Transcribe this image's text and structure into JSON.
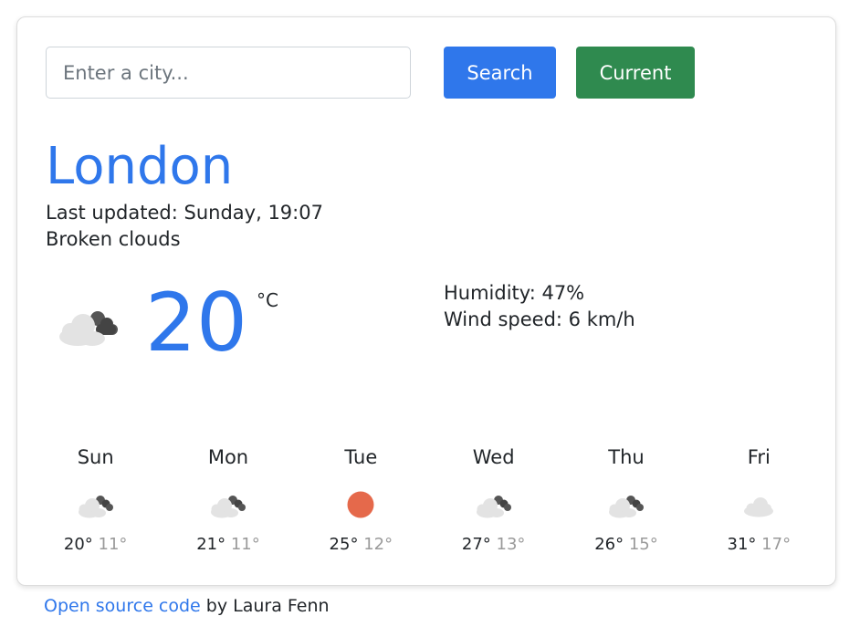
{
  "search": {
    "placeholder": "Enter a city...",
    "value": "",
    "search_label": "Search",
    "current_label": "Current"
  },
  "weather": {
    "city": "London",
    "last_updated_label": "Last updated:",
    "last_updated_value": "Sunday, 19:07",
    "description": "Broken clouds",
    "temperature": "20",
    "unit": "°C",
    "icon": "broken-clouds-icon",
    "humidity_label": "Humidity:",
    "humidity_value": "47%",
    "wind_label": "Wind speed:",
    "wind_value": "6 km/h"
  },
  "forecast": [
    {
      "day": "Sun",
      "max": "20°",
      "min": "11°",
      "icon": "broken-clouds-icon"
    },
    {
      "day": "Mon",
      "max": "21°",
      "min": "11°",
      "icon": "broken-clouds-icon"
    },
    {
      "day": "Tue",
      "max": "25°",
      "min": "12°",
      "icon": "clear-sun-icon"
    },
    {
      "day": "Wed",
      "max": "27°",
      "min": "13°",
      "icon": "broken-clouds-icon"
    },
    {
      "day": "Thu",
      "max": "26°",
      "min": "15°",
      "icon": "broken-clouds-icon"
    },
    {
      "day": "Fri",
      "max": "31°",
      "min": "17°",
      "icon": "cloud-icon"
    }
  ],
  "footer": {
    "link_text": "Open source code",
    "suffix": "by Laura Fenn"
  },
  "colors": {
    "accent": "#2f77eb",
    "search_button": "#2f77eb",
    "current_button": "#2f8a4f",
    "sun": "#e5694b"
  }
}
